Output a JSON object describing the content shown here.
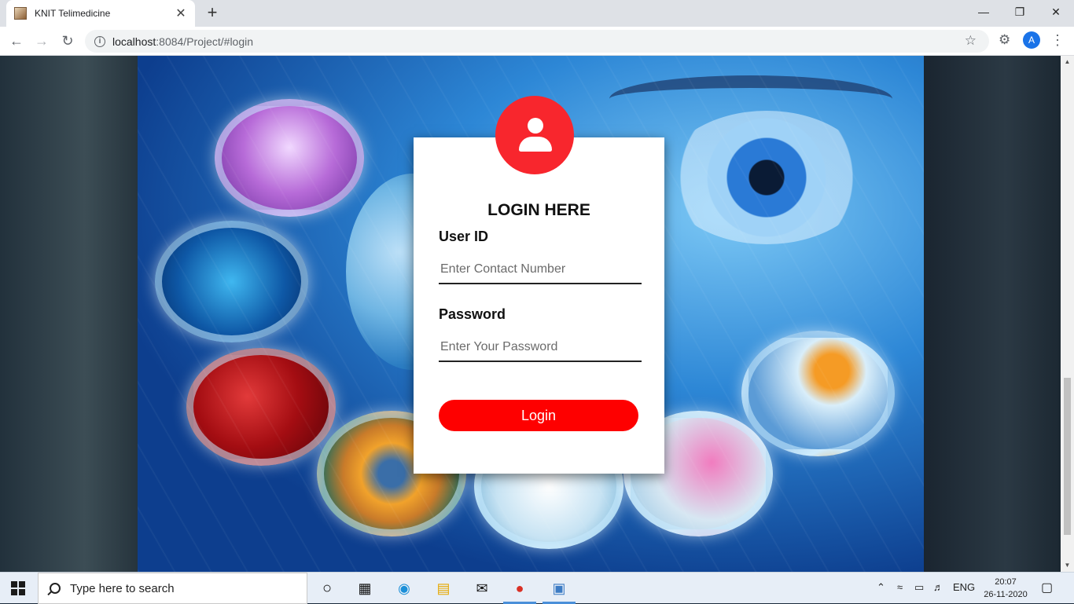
{
  "browser": {
    "tab_title": "KNIT Telimedicine",
    "tab_close": "✕",
    "new_tab": "+",
    "url_host": "localhost",
    "url_rest": ":8084/Project/#login",
    "profile_initial": "A"
  },
  "login": {
    "title": "LOGIN HERE",
    "user_label": "User ID",
    "user_placeholder": "Enter Contact Number",
    "password_label": "Password",
    "password_placeholder": "Enter Your Password",
    "button_label": "Login",
    "accent_color": "#fe0000"
  },
  "taskbar": {
    "search_placeholder": "Type here to search",
    "language": "ENG",
    "time": "20:07",
    "date": "26-11-2020"
  }
}
